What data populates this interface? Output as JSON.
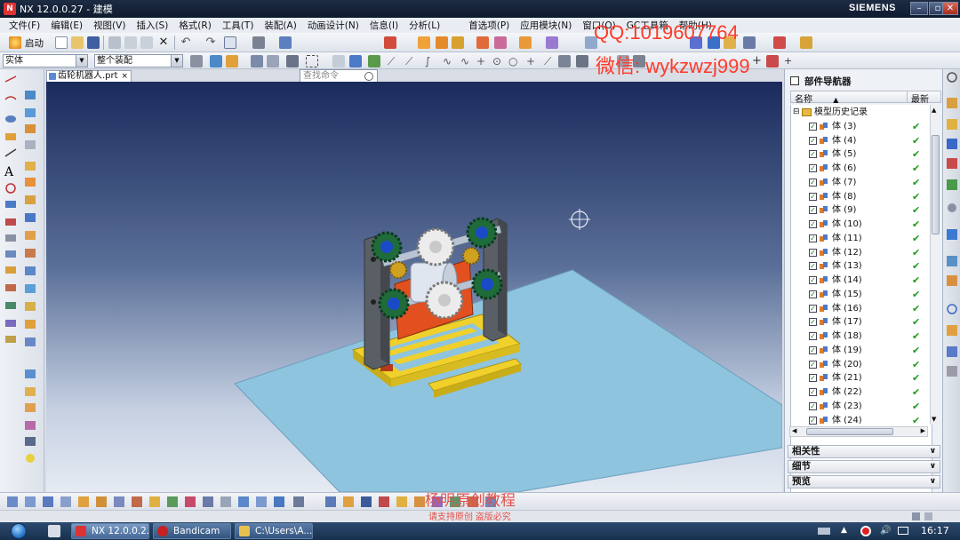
{
  "window": {
    "title": "NX 12.0.0.27 - 建模",
    "brand": "SIEMENS",
    "minimize": "–",
    "restore": "▫",
    "close": "✕"
  },
  "menus": [
    "文件(F)",
    "编辑(E)",
    "视图(V)",
    "插入(S)",
    "格式(R)",
    "工具(T)",
    "装配(A)",
    "动画设计(N)",
    "信息(I)",
    "分析(L)",
    "首选项(P)",
    "应用模块(N)",
    "窗口(O)",
    "GC工具箱",
    "帮助(H)"
  ],
  "toolbar": {
    "start_label": "启动",
    "search_placeholder": "查找命令",
    "filter_type": "实体",
    "filter_scope": "整个装配"
  },
  "watermarks": {
    "qq": "QQ:1019607764",
    "wechat": "微信: wykzwzj999",
    "bottom_title": "杨明原创教程",
    "bottom_sub": "请支持原创 盗版必究"
  },
  "document_tab": {
    "label": "齿轮机器人.prt",
    "close": "×"
  },
  "navigator": {
    "title": "部件导航器",
    "col_name": "名称",
    "col_sort": "▲",
    "col_latest": "最新",
    "root": "模型历史记录",
    "items": [
      {
        "label": "体 (3)"
      },
      {
        "label": "体 (4)"
      },
      {
        "label": "体 (5)"
      },
      {
        "label": "体 (6)"
      },
      {
        "label": "体 (7)"
      },
      {
        "label": "体 (8)"
      },
      {
        "label": "体 (9)"
      },
      {
        "label": "体 (10)"
      },
      {
        "label": "体 (11)"
      },
      {
        "label": "体 (12)"
      },
      {
        "label": "体 (13)"
      },
      {
        "label": "体 (14)"
      },
      {
        "label": "体 (15)"
      },
      {
        "label": "体 (16)"
      },
      {
        "label": "体 (17)"
      },
      {
        "label": "体 (18)"
      },
      {
        "label": "体 (19)"
      },
      {
        "label": "体 (20)"
      },
      {
        "label": "体 (21)"
      },
      {
        "label": "体 (22)"
      },
      {
        "label": "体 (23)"
      },
      {
        "label": "体 (24)"
      }
    ],
    "tick": "✔",
    "sections": [
      "相关性",
      "细节",
      "预览"
    ]
  },
  "taskbar": {
    "items": [
      "NX 12.0.0.2...",
      "Bandicam",
      "C:\\Users\\A..."
    ],
    "clock": "16:17"
  },
  "colors": {
    "title_bg": "#0e1a2e",
    "watermark": "#ff3a2a",
    "gear_green": "#1f6b3a",
    "frame_gray": "#5a5f66",
    "base_yellow": "#f0d02a",
    "plate_blue": "#8fc4df",
    "motor_orange": "#e2501f"
  }
}
